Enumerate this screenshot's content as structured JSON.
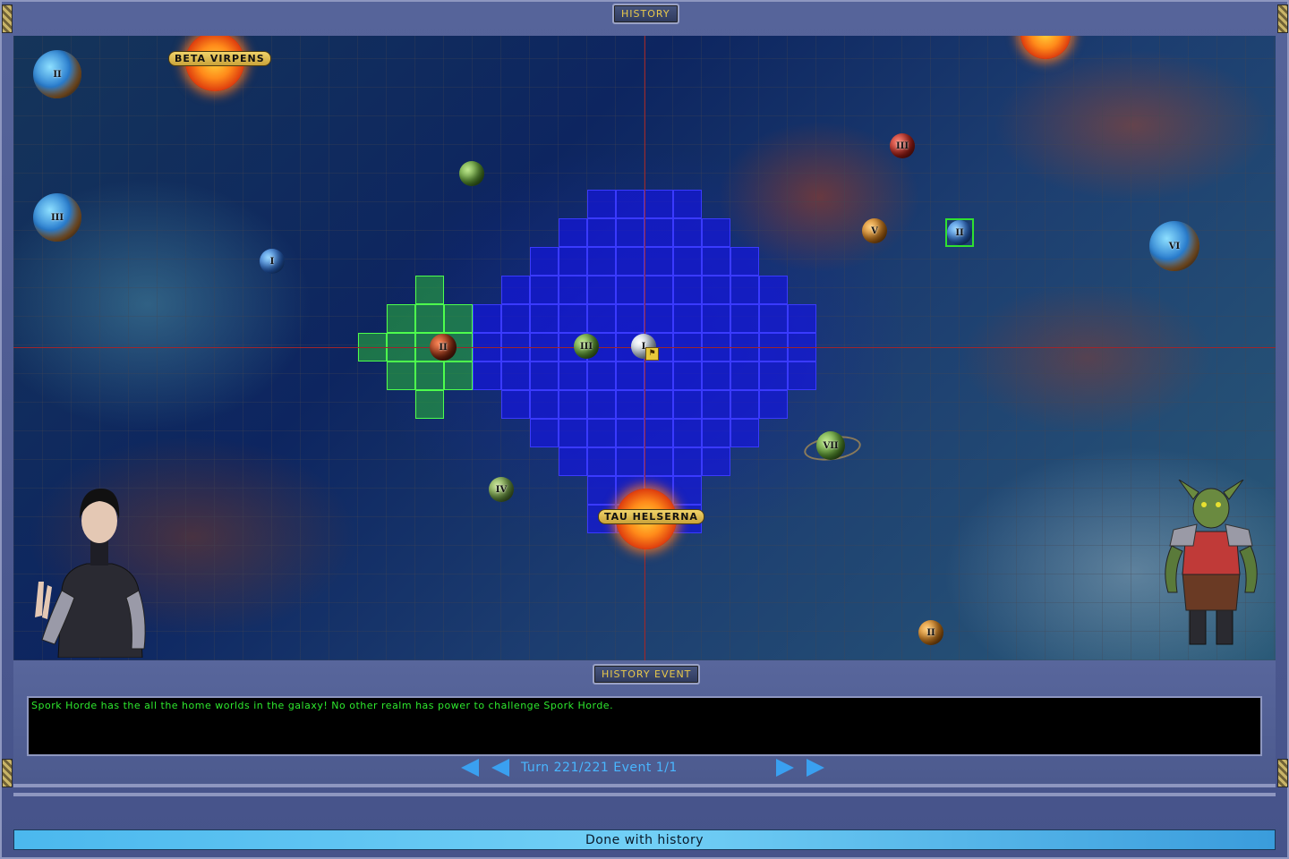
{
  "window": {
    "title": "History"
  },
  "map": {
    "stars": [
      {
        "label": "Beta Virpens"
      },
      {
        "label": "Tau Helserna"
      }
    ],
    "planets": [
      "II",
      "III",
      "I",
      "III",
      "V",
      "II",
      "VI",
      "II",
      "III",
      "I",
      "VII",
      "IV",
      "II"
    ]
  },
  "event_panel": {
    "title": "History Event",
    "message": "Spork Horde has the all the home worlds in the galaxy! No other realm has power to challenge Spork Horde.",
    "turn_label": "Turn 221/221 Event 1/1"
  },
  "footer": {
    "done_label": "Done with history"
  },
  "colors": {
    "panel": "#4c5a8c",
    "territory_blue": "#1414e6",
    "territory_green": "#28aa3c",
    "message_text": "#2ee82e",
    "nav_accent": "#3aa0f0",
    "title_text": "#e8c84a"
  }
}
